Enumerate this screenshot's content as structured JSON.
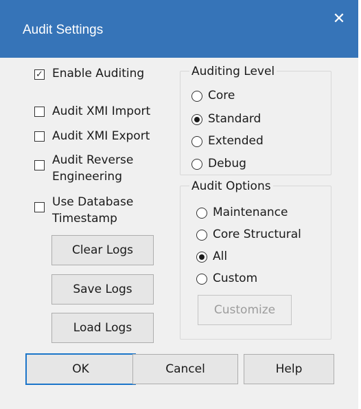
{
  "window": {
    "title": "Audit Settings",
    "close_glyph": "✕"
  },
  "options": {
    "enable_auditing": {
      "label": "Enable Auditing",
      "checked": true
    },
    "audit_xmi_import": {
      "label": "Audit XMI Import",
      "checked": false
    },
    "audit_xmi_export": {
      "label": "Audit XMI Export",
      "checked": false
    },
    "audit_reverse_engineering": {
      "label": "Audit Reverse Engineering",
      "checked": false
    },
    "use_database_timestamp": {
      "label": "Use Database Timestamp",
      "checked": false
    }
  },
  "log_buttons": {
    "clear": "Clear Logs",
    "save": "Save Logs",
    "load": "Load Logs"
  },
  "auditing_level": {
    "title": "Auditing Level",
    "options": [
      "Core",
      "Standard",
      "Extended",
      "Debug"
    ],
    "selected": "Standard"
  },
  "audit_options": {
    "title": "Audit Options",
    "options": [
      "Maintenance",
      "Core Structural",
      "All",
      "Custom"
    ],
    "selected": "All",
    "customize_label": "Customize",
    "customize_enabled": false
  },
  "footer": {
    "ok": "OK",
    "cancel": "Cancel",
    "help": "Help"
  },
  "colors": {
    "titlebar": "#3674b8",
    "dialog_bg": "#f0f0f0",
    "default_button_border": "#1b75c9"
  }
}
